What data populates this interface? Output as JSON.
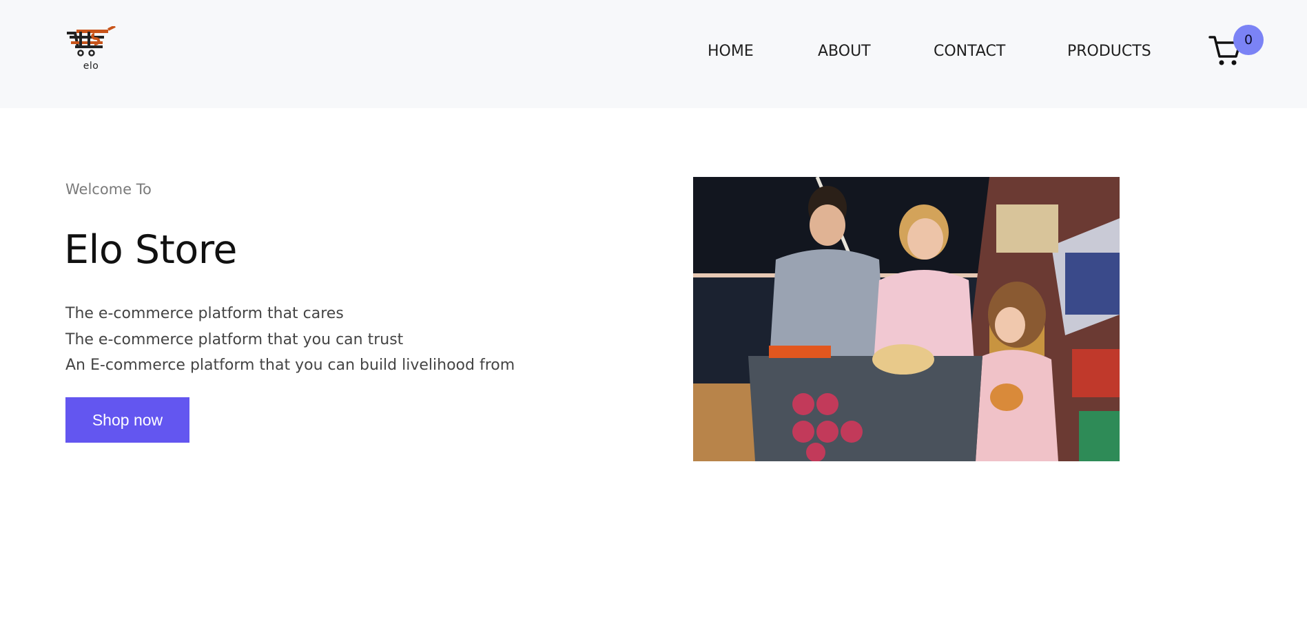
{
  "header": {
    "logo": {
      "text": "elo",
      "icon": "shopping-cart-logo-icon"
    },
    "nav": [
      {
        "label": "HOME"
      },
      {
        "label": "ABOUT"
      },
      {
        "label": "CONTACT"
      },
      {
        "label": "PRODUCTS"
      }
    ],
    "cart": {
      "icon": "cart-icon",
      "count": "0"
    }
  },
  "hero": {
    "welcome": "Welcome To",
    "title": "Elo Store",
    "taglines": [
      "The e-commerce platform that cares",
      "The e-commerce platform that you can trust",
      "An E-commerce platform that you can build livelihood from"
    ],
    "cta": "Shop now",
    "image": {
      "subject": "family-shopping-photo"
    }
  },
  "colors": {
    "header_bg": "#f7f8fa",
    "accent": "#6356f0",
    "badge": "#7b83f5",
    "logo_orange": "#c8541a"
  }
}
